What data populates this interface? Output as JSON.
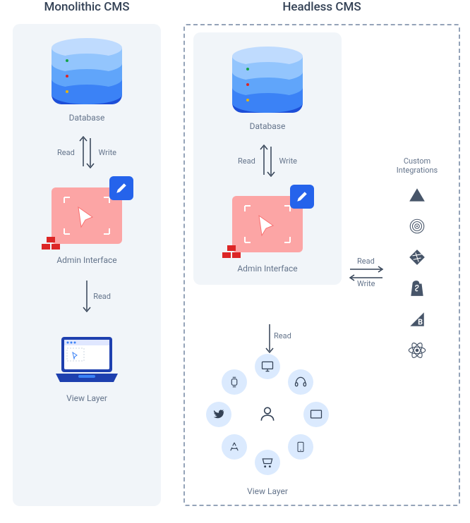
{
  "left": {
    "title": "Monolithic CMS",
    "database": "Database",
    "read": "Read",
    "write": "Write",
    "admin": "Admin Interface",
    "view": "View Layer"
  },
  "right": {
    "title": "Headless CMS",
    "database": "Database",
    "read": "Read",
    "write": "Write",
    "admin": "Admin Interface",
    "view": "View Layer",
    "integrations": "Custom Integrations",
    "icons": [
      "vercel",
      "circleci",
      "netlify",
      "shopify",
      "bigcommerce",
      "react"
    ],
    "channels": [
      "desktop",
      "watch",
      "headset",
      "twitter",
      "monitor",
      "appstore",
      "cart",
      "phone"
    ]
  }
}
